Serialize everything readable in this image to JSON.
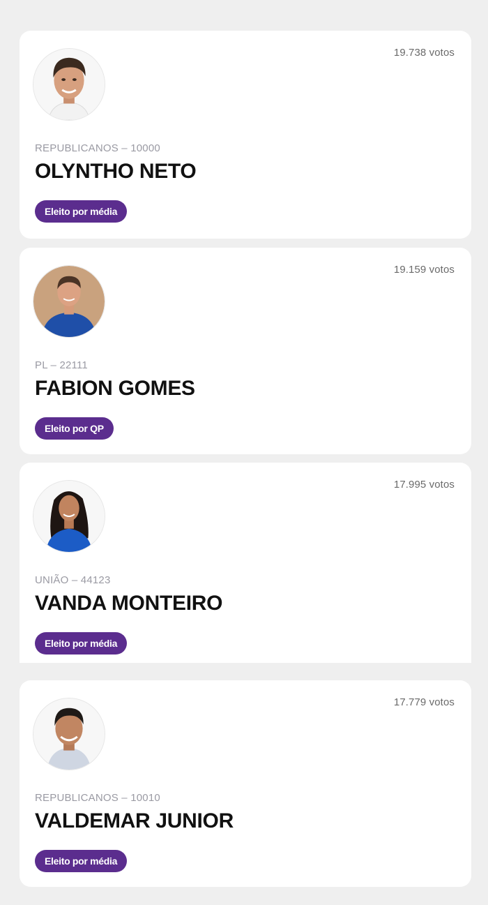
{
  "candidates": [
    {
      "votes": "19.738 votos",
      "party": "REPUBLICANOS – 10000",
      "name": "OLYNTHO NETO",
      "status": "Eleito por média",
      "photo": "man-white-shirt"
    },
    {
      "votes": "19.159 votos",
      "party": "PL – 22111",
      "name": "FABION GOMES",
      "status": "Eleito por QP",
      "photo": "man-blue-shirt"
    },
    {
      "votes": "17.995 votos",
      "party": "UNIÃO – 44123",
      "name": "VANDA MONTEIRO",
      "status": "Eleito por média",
      "photo": "woman-blue-dress"
    },
    {
      "votes": "17.779 votos",
      "party": "REPUBLICANOS – 10010",
      "name": "VALDEMAR JUNIOR",
      "status": "Eleito por média",
      "photo": "man-light-shirt"
    }
  ],
  "colors": {
    "badge": "#5b2d8e",
    "page_background": "#efefef",
    "card_background": "#ffffff"
  }
}
